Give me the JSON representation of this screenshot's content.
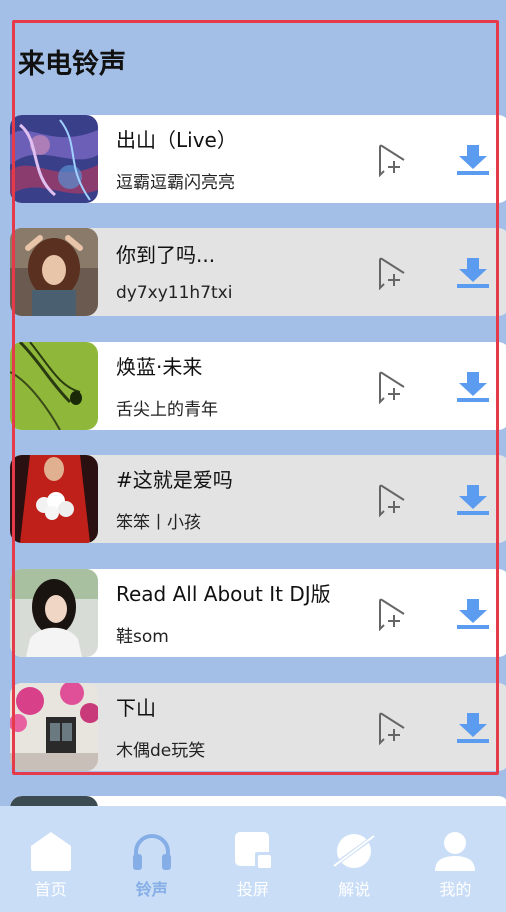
{
  "page": {
    "title": "来电铃声"
  },
  "songs": [
    {
      "title": "出山（Live）",
      "artist": "逗霸逗霸闪亮亮",
      "cover": "abstract-blue-purple"
    },
    {
      "title": "你到了吗...",
      "artist": "dy7xy11h7txi",
      "cover": "girl-portrait"
    },
    {
      "title": "焕蓝·未来",
      "artist": "舌尖上的青年",
      "cover": "green-leaf"
    },
    {
      "title": "#这就是爱吗",
      "artist": "笨笨丨小孩",
      "cover": "red-dress-flowers"
    },
    {
      "title": "Read All About It   DJ版",
      "artist": "鞋som",
      "cover": "woman-portrait"
    },
    {
      "title": "下山",
      "artist": "木偶de玩笑",
      "cover": "flowers-window"
    }
  ],
  "tabs": [
    {
      "label": "首页",
      "icon": "home-icon",
      "active": false
    },
    {
      "label": "铃声",
      "icon": "headphones-icon",
      "active": true
    },
    {
      "label": "投屏",
      "icon": "cast-screen-icon",
      "active": false
    },
    {
      "label": "解说",
      "icon": "planet-icon",
      "active": false
    },
    {
      "label": "我的",
      "icon": "user-icon",
      "active": false
    }
  ],
  "colors": {
    "background": "#a3bfe8",
    "accent_blue": "#5b9cf0",
    "tab_active": "#86aee6",
    "tabbar_bg": "#c9ddf7",
    "selection_frame": "#e53a4a"
  }
}
